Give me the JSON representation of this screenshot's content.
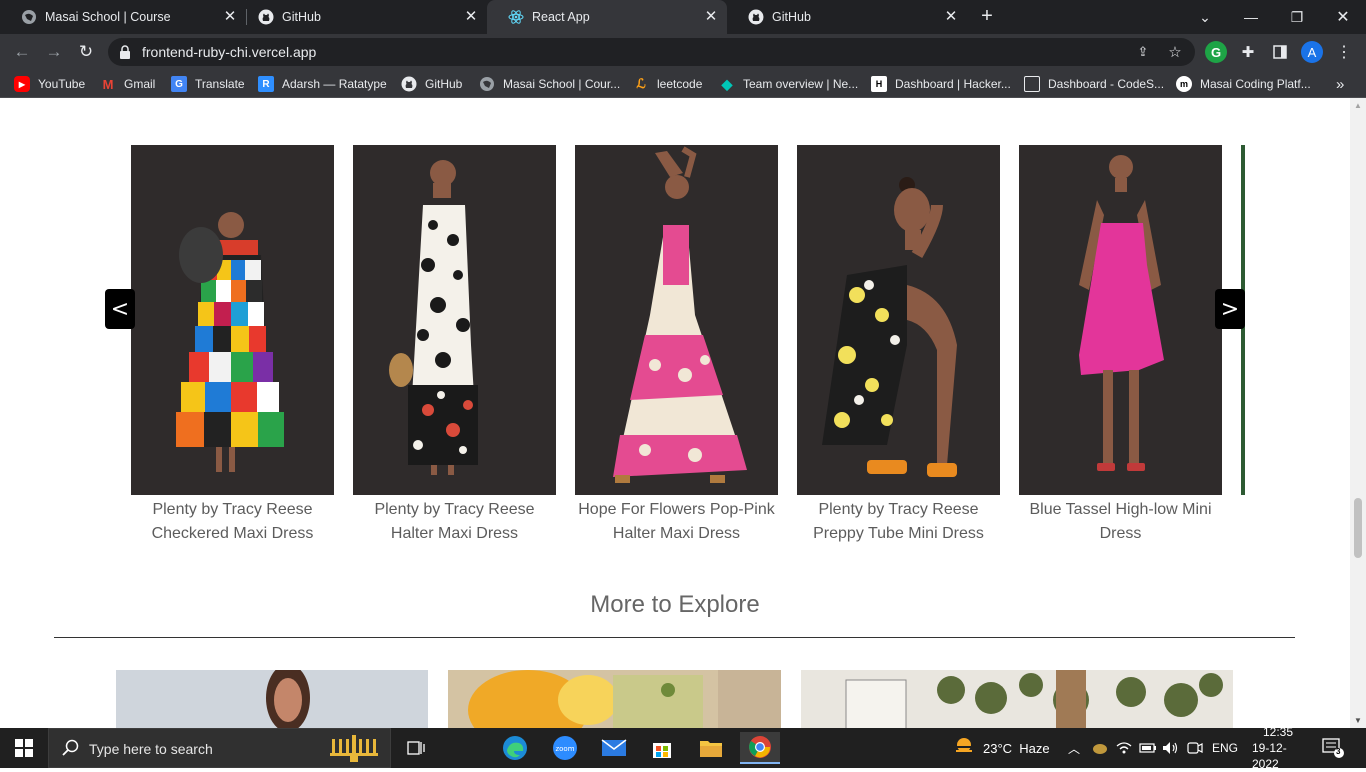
{
  "browser": {
    "tabs": [
      {
        "title": "Masai School | Course",
        "active": false
      },
      {
        "title": "GitHub",
        "active": false
      },
      {
        "title": "React App",
        "active": true
      },
      {
        "title": "GitHub",
        "active": false
      }
    ],
    "url": "frontend-ruby-chi.vercel.app",
    "profile_initial": "A",
    "extension_initial": "G",
    "bookmarks": [
      {
        "label": "YouTube",
        "icon": "youtube-icon"
      },
      {
        "label": "Gmail",
        "icon": "gmail-icon"
      },
      {
        "label": "Translate",
        "icon": "translate-icon"
      },
      {
        "label": "Adarsh — Ratatype",
        "icon": "ratatype-icon"
      },
      {
        "label": "GitHub",
        "icon": "github-icon"
      },
      {
        "label": "Masai School | Cour...",
        "icon": "globe-icon"
      },
      {
        "label": "leetcode",
        "icon": "leetcode-icon"
      },
      {
        "label": "Team overview | Ne...",
        "icon": "diamond-icon"
      },
      {
        "label": "Dashboard | Hacker...",
        "icon": "hackerrank-icon"
      },
      {
        "label": "Dashboard - CodeS...",
        "icon": "square-icon"
      },
      {
        "label": "Masai Coding Platf...",
        "icon": "masai-icon"
      }
    ],
    "more_bookmarks": "»"
  },
  "carousel": {
    "prev_label": "<",
    "next_label": ">",
    "products": [
      {
        "name": "Plenty by Tracy Reese Checkered Maxi Dress"
      },
      {
        "name": "Plenty by Tracy Reese Halter Maxi Dress"
      },
      {
        "name": "Hope For Flowers Pop-Pink Halter Maxi Dress"
      },
      {
        "name": "Plenty by Tracy Reese Preppy Tube Mini Dress"
      },
      {
        "name": "Blue Tassel High-low Mini Dress"
      }
    ]
  },
  "explore": {
    "title": "More to Explore"
  },
  "taskbar": {
    "search_placeholder": "Type here to search",
    "weather": "23°C  Haze",
    "language": "ENG",
    "time": "12:35",
    "date": "19-12-2022",
    "notification_count": "3",
    "zoom_label": "zoom"
  },
  "colors": {
    "tab_bar": "#202124",
    "toolbar": "#35363a",
    "carousel_button": "#000000",
    "caption_text": "#5c5c5c",
    "photo_backdrop": "#2f2b2b"
  }
}
